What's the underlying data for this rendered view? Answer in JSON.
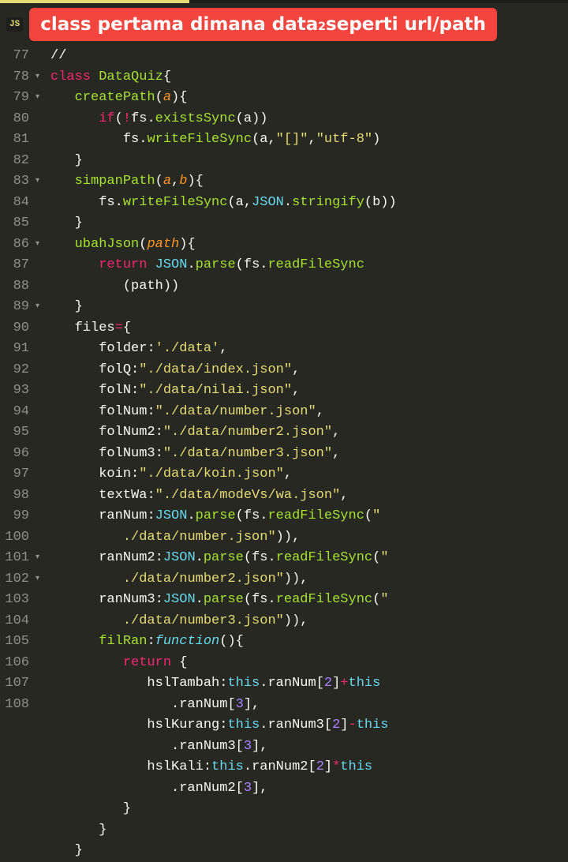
{
  "tab": {
    "file_badge": "JS"
  },
  "banner": {
    "prefix": "class pertama dimana data",
    "sup": "2",
    "suffix": " seperti url/path"
  },
  "gutter": [
    {
      "n": "77",
      "f": ""
    },
    {
      "n": "78",
      "f": "▾"
    },
    {
      "n": "79",
      "f": "▾"
    },
    {
      "n": "80",
      "f": ""
    },
    {
      "n": "81",
      "f": ""
    },
    {
      "n": "82",
      "f": ""
    },
    {
      "n": "83",
      "f": "▾"
    },
    {
      "n": "84",
      "f": ""
    },
    {
      "n": "85",
      "f": ""
    },
    {
      "n": "86",
      "f": "▾"
    },
    {
      "n": "87",
      "f": ""
    },
    {
      "n": "",
      "f": ""
    },
    {
      "n": "88",
      "f": ""
    },
    {
      "n": "89",
      "f": "▾"
    },
    {
      "n": "90",
      "f": ""
    },
    {
      "n": "91",
      "f": ""
    },
    {
      "n": "92",
      "f": ""
    },
    {
      "n": "93",
      "f": ""
    },
    {
      "n": "94",
      "f": ""
    },
    {
      "n": "95",
      "f": ""
    },
    {
      "n": "96",
      "f": ""
    },
    {
      "n": "97",
      "f": ""
    },
    {
      "n": "98",
      "f": ""
    },
    {
      "n": "",
      "f": ""
    },
    {
      "n": "99",
      "f": ""
    },
    {
      "n": "",
      "f": ""
    },
    {
      "n": "100",
      "f": ""
    },
    {
      "n": "",
      "f": ""
    },
    {
      "n": "101",
      "f": "▾"
    },
    {
      "n": "102",
      "f": "▾"
    },
    {
      "n": "103",
      "f": ""
    },
    {
      "n": "",
      "f": ""
    },
    {
      "n": "104",
      "f": ""
    },
    {
      "n": "",
      "f": ""
    },
    {
      "n": "105",
      "f": ""
    },
    {
      "n": "",
      "f": ""
    },
    {
      "n": "106",
      "f": ""
    },
    {
      "n": "107",
      "f": ""
    },
    {
      "n": "108",
      "f": ""
    }
  ],
  "code": {
    "l77": "//",
    "class_kw": "class",
    "class_name": "DataQuiz",
    "m1": "createPath",
    "p_a": "a",
    "p_b": "b",
    "p_path": "path",
    "if_kw": "if",
    "not": "!",
    "fs": "fs",
    "existsSync": "existsSync",
    "writeFileSync": "writeFileSync",
    "s_empty": "\"[]\"",
    "s_utf8": "\"utf-8\"",
    "m2": "simpanPath",
    "JSON": "JSON",
    "stringify": "stringify",
    "m3": "ubahJson",
    "return_kw": "return",
    "parse": "parse",
    "readFileSync": "readFileSync",
    "files": "files",
    "k_folder": "folder",
    "v_folder": "'./data'",
    "k_folQ": "folQ",
    "v_folQ": "\"./data/index.json\"",
    "k_folN": "folN",
    "v_folN": "\"./data/nilai.json\"",
    "k_folNum": "folNum",
    "v_folNum": "\"./data/number.json\"",
    "k_folNum2": "folNum2",
    "v_folNum2": "\"./data/number2.json\"",
    "k_folNum3": "folNum3",
    "v_folNum3": "\"./data/number3.json\"",
    "k_koin": "koin",
    "v_koin": "\"./data/koin.json\"",
    "k_textWa": "textWa",
    "v_textWa": "\"./data/modeVs/wa.json\"",
    "k_ranNum": "ranNum",
    "rfs_open": "(fs.readFileSync(",
    "q": "\"",
    "path_num": "./data/number.json",
    "path_num2": "./data/number2.json",
    "path_num3": "./data/number3.json",
    "close_paren2": "))",
    "k_ranNum2": "ranNum2",
    "k_ranNum3": "ranNum3",
    "k_filRan": "filRan",
    "function_kw": "function",
    "k_hslTambah": "hslTambah",
    "k_hslKurang": "hslKurang",
    "k_hslKali": "hslKali",
    "this": "this",
    "ranNum": "ranNum",
    "ranNum2": "ranNum2",
    "ranNum3": "ranNum3",
    "n2": "2",
    "n3": "3",
    "plus": "+",
    "minus": "-",
    "star": "*"
  }
}
